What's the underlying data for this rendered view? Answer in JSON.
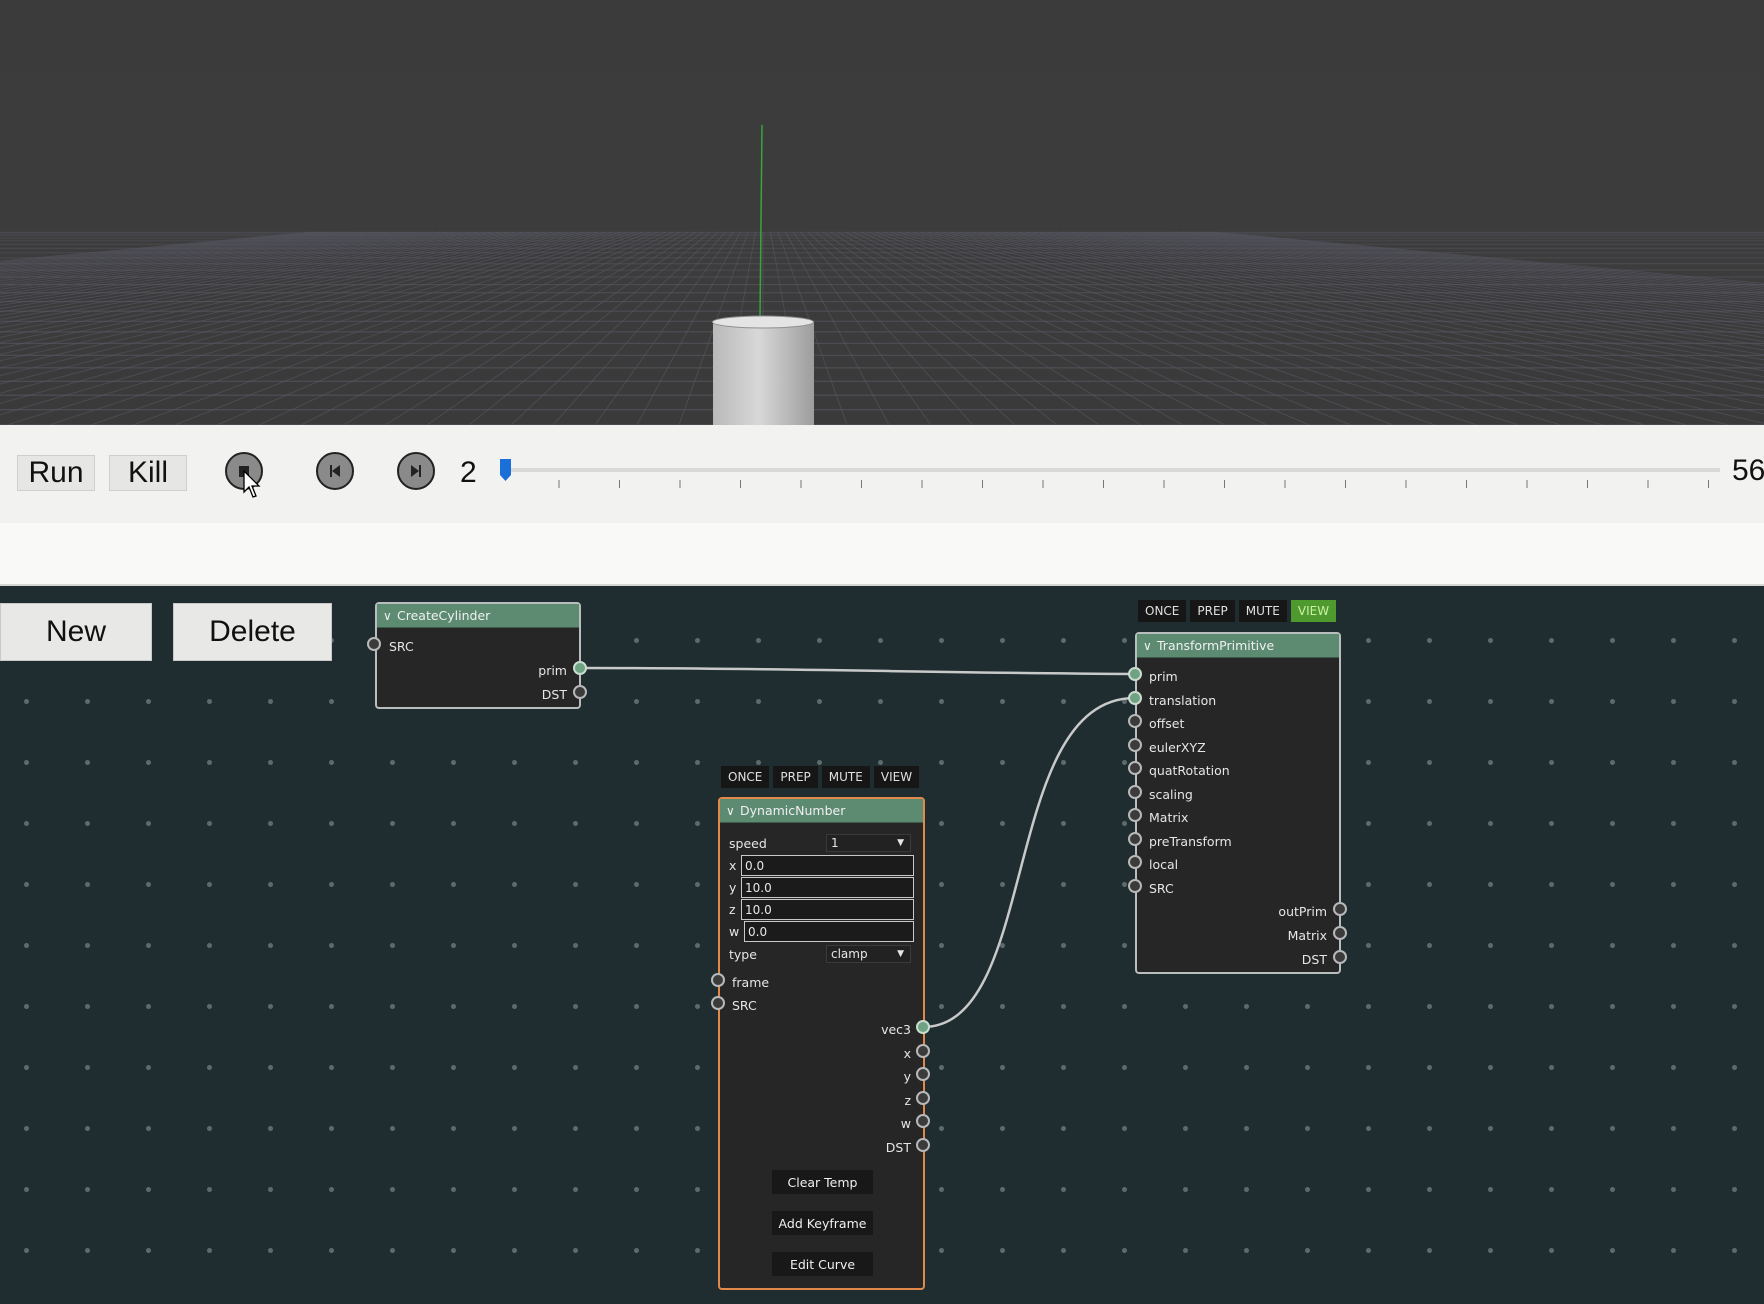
{
  "toolbar": {
    "run_label": "Run",
    "kill_label": "Kill",
    "stop_icon": "stop-icon",
    "step_back_icon": "step-back-icon",
    "step_forward_icon": "step-forward-icon",
    "current_frame": "2",
    "end_frame": "56",
    "accent": "#1a6fd9"
  },
  "graph_buttons": {
    "new_label": "New",
    "delete_label": "Delete"
  },
  "nodes": {
    "create_cylinder": {
      "title": "CreateCylinder",
      "inputs": [
        "SRC"
      ],
      "outputs": [
        "prim",
        "DST"
      ]
    },
    "transform_primitive": {
      "title": "TransformPrimitive",
      "flags": [
        "ONCE",
        "PREP",
        "MUTE",
        "VIEW"
      ],
      "active_flag": "VIEW",
      "inputs": [
        "prim",
        "translation",
        "offset",
        "eulerXYZ",
        "quatRotation",
        "scaling",
        "Matrix",
        "preTransform",
        "local",
        "SRC"
      ],
      "outputs": [
        "outPrim",
        "Matrix",
        "DST"
      ]
    },
    "dynamic_number": {
      "title": "DynamicNumber",
      "flags": [
        "ONCE",
        "PREP",
        "MUTE",
        "VIEW"
      ],
      "params": {
        "speed_label": "speed",
        "speed_value": "1",
        "x_label": "x",
        "x_value": "0.0",
        "y_label": "y",
        "y_value": "10.0",
        "z_label": "z",
        "z_value": "10.0",
        "w_label": "w",
        "w_value": "0.0",
        "type_label": "type",
        "type_value": "clamp"
      },
      "inputs": [
        "frame",
        "SRC"
      ],
      "outputs": [
        "vec3",
        "x",
        "y",
        "z",
        "w",
        "DST"
      ],
      "buttons": [
        "Clear Temp",
        "Add Keyframe",
        "Edit Curve"
      ]
    }
  }
}
